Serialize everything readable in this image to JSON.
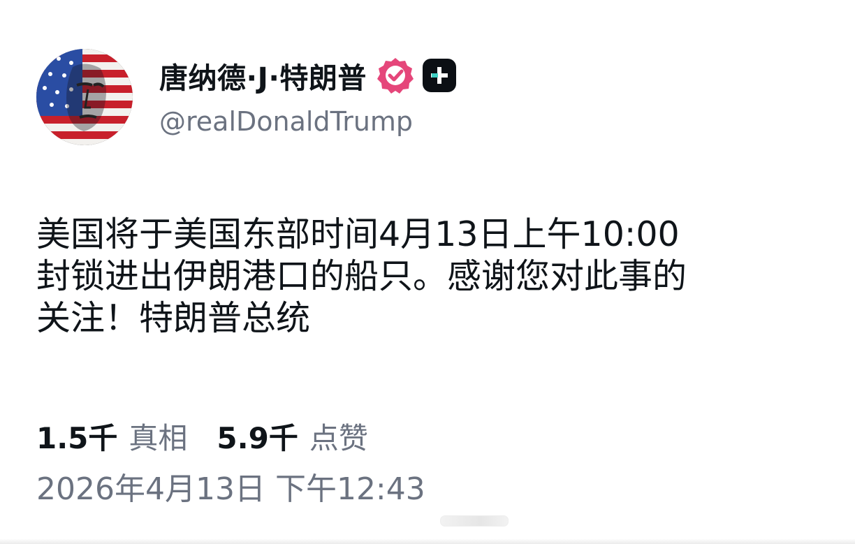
{
  "author": {
    "display_name": "唐纳德·J·特朗普",
    "handle": "@realDonaldTrump",
    "verified_icon": "verified-badge-icon",
    "plus_icon": "plus-badge-icon"
  },
  "post": {
    "text": "美国将于美国东部时间4月13日上午10:00\n封锁进出伊朗港口的船只。感谢您对此事的\n关注！特朗普总统"
  },
  "stats": {
    "truths_count": "1.5千",
    "truths_label": "真相",
    "likes_count": "5.9千",
    "likes_label": "点赞"
  },
  "timestamp": "2026年4月13日 下午12:43",
  "colors": {
    "text_primary": "#0f1419",
    "text_secondary": "#6b7280",
    "verified_pink": "#e5467a",
    "badge_dark": "#0b0f14",
    "badge_plus_accent": "#3fd0c4"
  }
}
